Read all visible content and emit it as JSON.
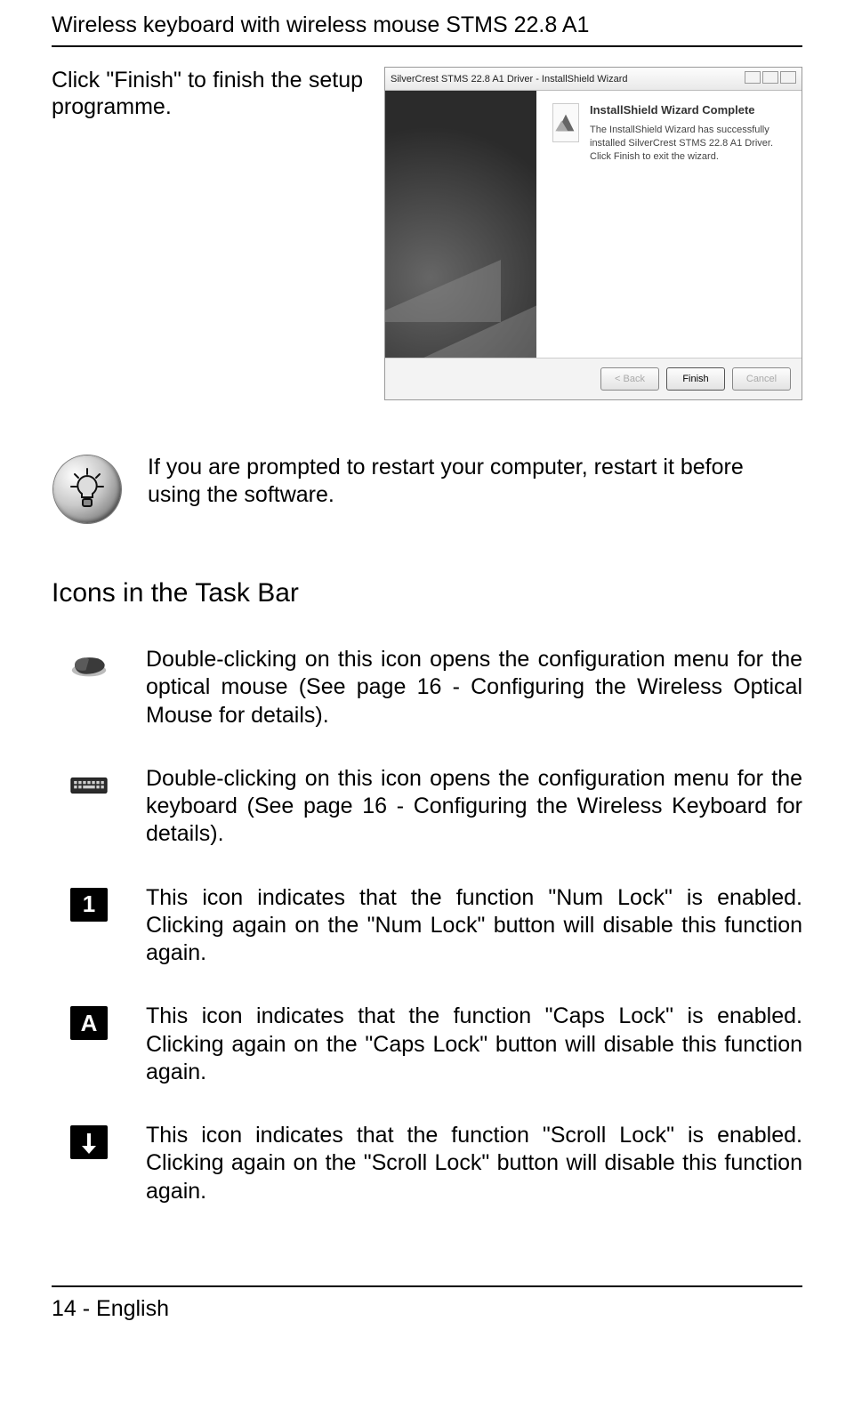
{
  "title": "Wireless keyboard with wireless mouse STMS 22.8 A1",
  "intro": "Click \"Finish\" to finish the setup programme.",
  "wizard": {
    "windowTitle": "SilverCrest STMS 22.8 A1 Driver - InstallShield Wizard",
    "heading": "InstallShield Wizard Complete",
    "body": "The InstallShield Wizard has successfully installed SilverCrest STMS 22.8 A1 Driver. Click Finish to exit the wizard.",
    "buttons": {
      "back": "< Back",
      "finish": "Finish",
      "cancel": "Cancel"
    }
  },
  "tip": "If you are prompted to restart your computer, restart it before using the software.",
  "sectionHeading": "Icons in the Task Bar",
  "items": [
    {
      "icon": "mouse",
      "text": "Double-clicking on this icon opens the configuration menu for the optical mouse (See page 16 - Configuring the Wireless Optical Mouse for details)."
    },
    {
      "icon": "keyboard",
      "text": "Double-clicking on this icon opens the configuration menu for the keyboard (See page 16 - Configuring the Wireless Keyboard for details)."
    },
    {
      "icon": "numlock",
      "text": "This icon indicates that the function \"Num Lock\" is enabled. Clicking again on the \"Num Lock\" button will disable this function again."
    },
    {
      "icon": "capslock",
      "text": "This icon indicates that the function \"Caps Lock\" is enabled. Clicking again on the \"Caps Lock\" button will disable this function again."
    },
    {
      "icon": "scrolllock",
      "text": "This icon indicates that the function \"Scroll Lock\" is enabled. Clicking again on the \"Scroll Lock\" button will disable this function again."
    }
  ],
  "footer": "14  -  English"
}
